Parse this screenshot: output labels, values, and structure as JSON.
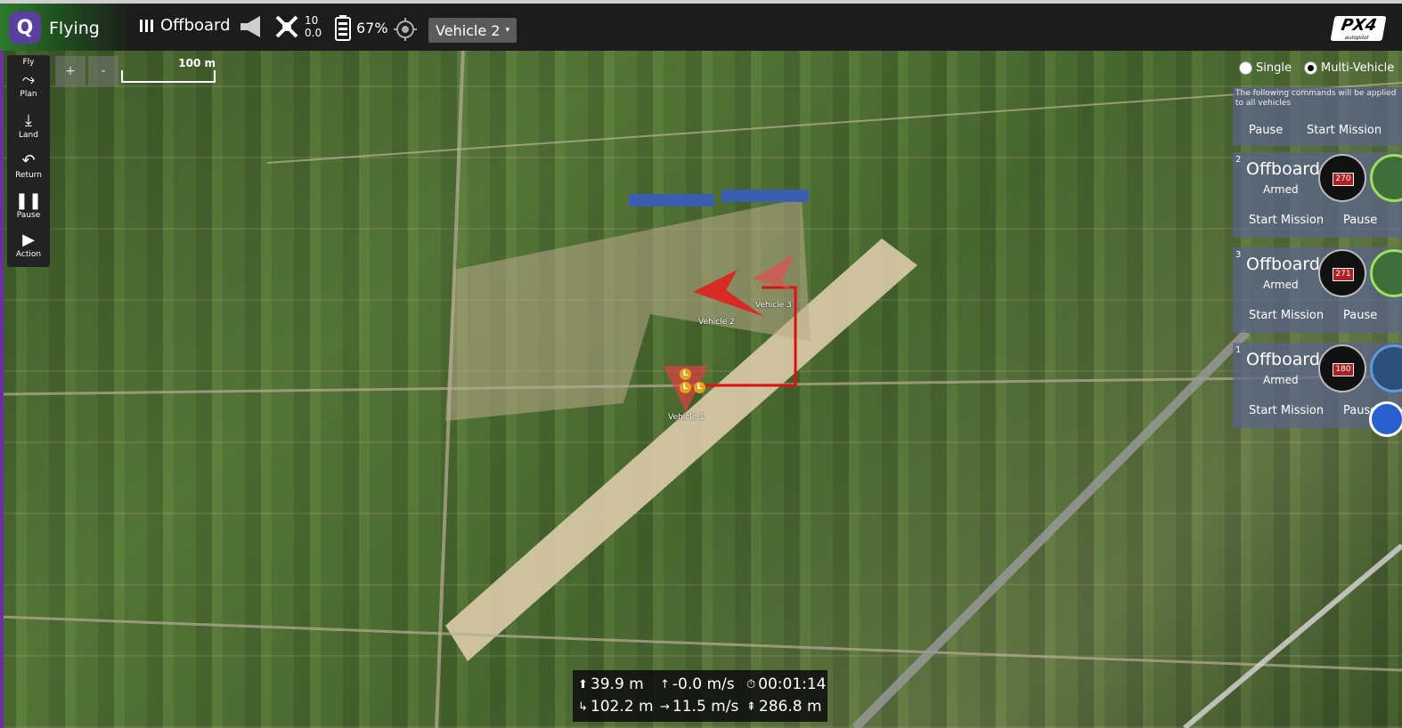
{
  "topbar": {
    "flight_mode": "Flying",
    "mode_label": "Offboard",
    "gps_sats": "10",
    "gps_hdop": "0.0",
    "battery": "67%",
    "vehicle_selector": "Vehicle 2",
    "brand_text": "PX4",
    "brand_subtext": "autopilot"
  },
  "toolstrip": {
    "items": [
      {
        "label": "Fly"
      },
      {
        "label": "Plan"
      },
      {
        "label": "Land"
      },
      {
        "label": "Return"
      },
      {
        "label": "Pause"
      },
      {
        "label": "Action"
      }
    ]
  },
  "map": {
    "zoom_in": "+",
    "zoom_out": "-",
    "scale_label": "100 m",
    "vehicles": [
      {
        "label": "Vehicle 2"
      },
      {
        "label": "Vehicle 3"
      },
      {
        "label": "Vehicle 1"
      }
    ],
    "land_marker": "L"
  },
  "multi_vehicle": {
    "single_label": "Single",
    "multi_label": "Multi-Vehicle",
    "note": "The following commands will be applied to all vehicles",
    "pause_all": "Pause",
    "start_mission_all": "Start Mission",
    "cards": [
      {
        "id": "2",
        "mode": "Offboard",
        "status": "Armed",
        "heading": "270",
        "start": "Start Mission",
        "pause": "Pause"
      },
      {
        "id": "3",
        "mode": "Offboard",
        "status": "Armed",
        "heading": "271",
        "start": "Start Mission",
        "pause": "Pause"
      },
      {
        "id": "1",
        "mode": "Offboard",
        "status": "Armed",
        "heading": "180",
        "start": "Start Mission",
        "pause": "Pause"
      }
    ]
  },
  "telemetry": {
    "altitude": "39.9 m",
    "vertical_speed": "-0.0 m/s",
    "flight_time": "00:01:14",
    "distance_home": "102.2 m",
    "ground_speed": "11.5 m/s",
    "distance_traveled": "286.8 m"
  }
}
